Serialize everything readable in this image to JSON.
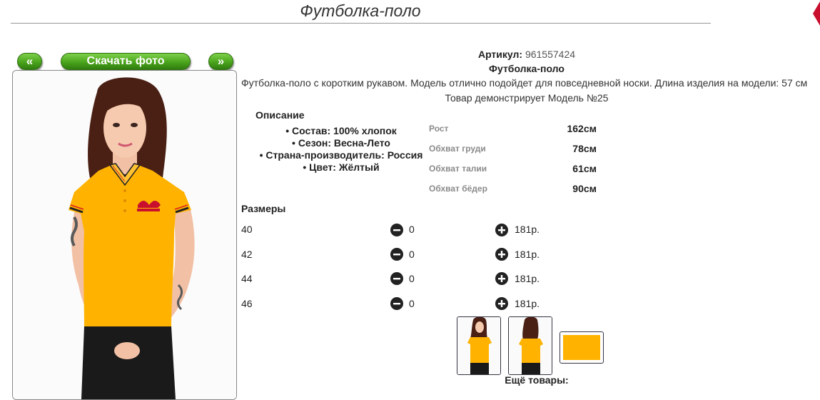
{
  "header": {
    "title": "Футболка-поло"
  },
  "gallery": {
    "prev_label": "«",
    "download_label": "Скачать фото",
    "next_label": "»"
  },
  "product": {
    "article_label": "Артикул:",
    "article_value": "961557424",
    "name": "Футболка-поло",
    "description": "Футболка-поло с коротким рукавом. Модель отлично подойдет для повседневной носки. Длина изделия на модели: 57 см",
    "model_note": "Товар демонстрирует Модель №25",
    "color_hex": "#ffb300"
  },
  "details": {
    "heading": "Описание",
    "items": [
      "• Состав: 100% хлопок",
      "• Сезон: Весна-Лето",
      "• Страна-производитель: Россия",
      "• Цвет: Жёлтый"
    ]
  },
  "measurements": [
    {
      "label": "Рост",
      "value": "162см"
    },
    {
      "label": "Обхват груди",
      "value": "78см"
    },
    {
      "label": "Обхват талии",
      "value": "61см"
    },
    {
      "label": "Обхват бёдер",
      "value": "90см"
    }
  ],
  "sizes": {
    "heading": "Размеры",
    "rows": [
      {
        "size": "40",
        "qty": "0",
        "price": "181р."
      },
      {
        "size": "42",
        "qty": "0",
        "price": "181р."
      },
      {
        "size": "44",
        "qty": "0",
        "price": "181р."
      },
      {
        "size": "46",
        "qty": "0",
        "price": "181р."
      }
    ]
  },
  "more": {
    "heading": "Ещё товары:"
  }
}
